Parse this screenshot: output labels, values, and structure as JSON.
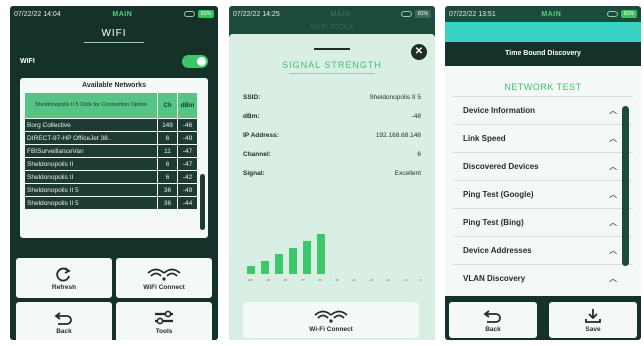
{
  "colors": {
    "accent": "#3cc86a",
    "dark_bg": "#14322a",
    "light_panel": "#f4f8f6",
    "teal": "#39d3c4"
  },
  "screen1": {
    "status": {
      "time": "07/22/22 14:04",
      "mode": "MAIN",
      "battery": "81%"
    },
    "title": "WIFI",
    "wifi_label": "WIFI",
    "wifi_enabled": true,
    "networks": {
      "heading": "Available Networks",
      "selected_hint": "Sheldonopolis II 5 Click for Connection Option",
      "col_ch": "Ch",
      "col_dbm": "dBm",
      "rows": [
        {
          "name": "Borg Collective",
          "ch": "149",
          "dbm": "-46"
        },
        {
          "name": "DIRECT-97-HP OfficeJet 38..",
          "ch": "6",
          "dbm": "-49"
        },
        {
          "name": "FBISurveillanceVan",
          "ch": "11",
          "dbm": "-47"
        },
        {
          "name": "Sheldonopolis II",
          "ch": "6",
          "dbm": "-47"
        },
        {
          "name": "Sheldonopolis II",
          "ch": "6",
          "dbm": "-42"
        },
        {
          "name": "Sheldonopolis II 5",
          "ch": "36",
          "dbm": "-49"
        },
        {
          "name": "Sheldonopolis II 5",
          "ch": "36",
          "dbm": "-44"
        }
      ]
    },
    "buttons": {
      "refresh": "Refresh",
      "wifi_connect": "WiFi Connect",
      "back": "Back",
      "tools": "Tools"
    }
  },
  "screen2": {
    "status": {
      "time": "07/22/22 14:25",
      "mode": "MAIN",
      "battery": "81%"
    },
    "dim_title": "WI-FI TOOLS",
    "signal_title": "SIGNAL STRENGTH",
    "info": [
      {
        "key": "SSID:",
        "value": "Sheldonopolis II 5"
      },
      {
        "key": "dBm:",
        "value": "-48"
      },
      {
        "key": "IP Address:",
        "value": "192.168.68.148"
      },
      {
        "key": "Channel:",
        "value": "6"
      },
      {
        "key": "Signal:",
        "value": "Excellent"
      }
    ],
    "signal_levels": [
      0.18,
      0.3,
      0.45,
      0.6,
      0.75,
      0.9
    ],
    "axis_ticks": [
      "-100",
      "-90",
      "-80",
      "-70",
      "-60",
      "-50",
      "-40",
      "-30",
      "-20",
      "-10",
      "0"
    ],
    "wifi_connect": "Wi-Fi Connect"
  },
  "screen3": {
    "status": {
      "time": "07/22/22 13:51",
      "mode": "MAIN",
      "battery": "81%"
    },
    "section_title": "Time Bound Discovery",
    "list_heading": "NETWORK TEST",
    "items": [
      "Device Information",
      "Link Speed",
      "Discovered Devices",
      "Ping Test (Google)",
      "Ping Test (Bing)",
      "Device Addresses",
      "VLAN Discovery"
    ],
    "buttons": {
      "back": "Back",
      "save": "Save"
    }
  }
}
